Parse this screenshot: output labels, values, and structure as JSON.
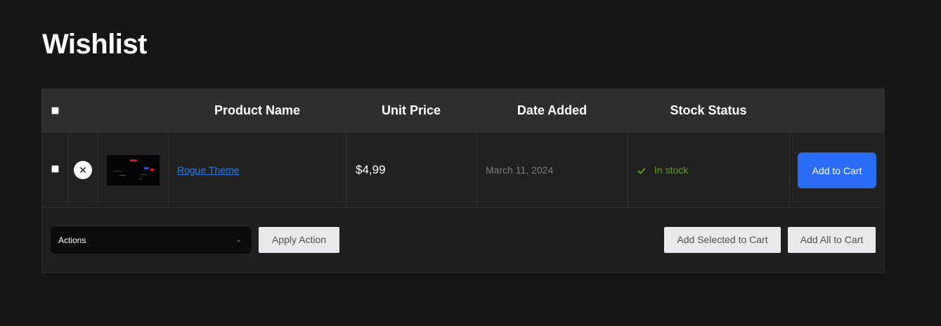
{
  "page": {
    "title": "Wishlist"
  },
  "table": {
    "headers": {
      "product_name": "Product Name",
      "unit_price": "Unit Price",
      "date_added": "Date Added",
      "stock_status": "Stock Status"
    },
    "rows": [
      {
        "product_name": "Rogue Theme",
        "unit_price": "$4,99",
        "date_added": "March 11, 2024",
        "stock_status": "In stock",
        "add_to_cart_label": "Add to Cart",
        "thumbnail_icon": "product-thumbnail-image"
      }
    ]
  },
  "footer": {
    "actions_select_value": "Actions",
    "apply_action_label": "Apply Action",
    "add_selected_label": "Add Selected to Cart",
    "add_all_label": "Add All to Cart"
  },
  "colors": {
    "background": "#161616",
    "accent_blue": "#2a6df4",
    "link_blue": "#2c7be5",
    "in_stock_green": "#5f9a2f"
  }
}
